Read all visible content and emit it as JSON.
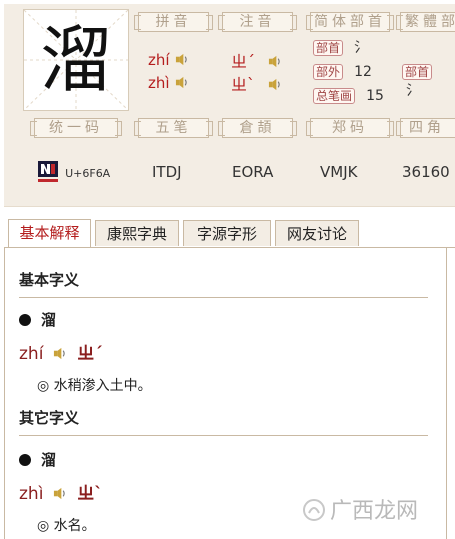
{
  "character": "溜",
  "headers": {
    "pinyin": "拼音",
    "zhuyin": "注音",
    "jianti_bushou": "简体部首",
    "fanti_bushou": "繁體部",
    "tongyima": "统一码",
    "wubi": "五笔",
    "cangjie": "倉頡",
    "zhengma": "郑码",
    "sijiao": "四角"
  },
  "pinyin": [
    "zhí",
    "zhì"
  ],
  "zhuyin": [
    "ㄓˊ",
    "ㄓˋ"
  ],
  "bushou": {
    "radical_label": "部首",
    "radical_value": "氵",
    "outside_label": "部外",
    "outside_value": "12",
    "total_label": "总笔画",
    "total_value": "15",
    "fanti_label": "部首",
    "fanti_value": "氵"
  },
  "codes": {
    "unicode": "U+6F6A",
    "wubi": "ITDJ",
    "cangjie": "EORA",
    "zhengma": "VMJK",
    "sijiao": "36160"
  },
  "tabs": [
    {
      "label": "基本解释",
      "active": true
    },
    {
      "label": "康熙字典",
      "active": false
    },
    {
      "label": "字源字形",
      "active": false
    },
    {
      "label": "网友讨论",
      "active": false
    }
  ],
  "sections": {
    "basic_title": "基本字义",
    "other_title": "其它字义"
  },
  "entries": [
    {
      "char": "溜",
      "pinyin": "zhí",
      "zhuyin": "ㄓˊ",
      "definition": "◎ 水稍渗入土中。"
    },
    {
      "char": "溜",
      "pinyin": "zhì",
      "zhuyin": "ㄓˋ",
      "definition": "◎ 水名。"
    }
  ],
  "watermark": "广西龙网",
  "colors": {
    "accent_red": "#b41e1e",
    "panel_bg": "#f3ede4",
    "border": "#c9b9a3"
  }
}
